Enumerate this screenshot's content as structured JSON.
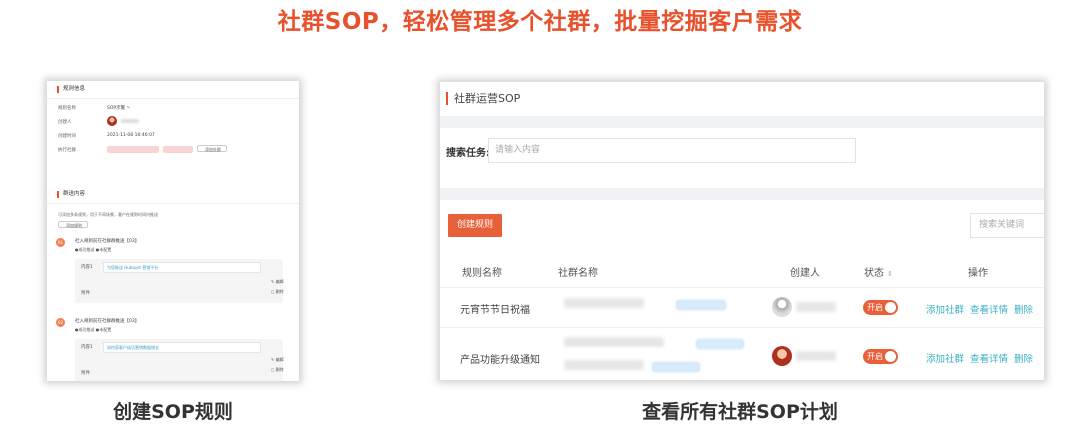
{
  "headline": "社群SOP，轻松管理多个社群，批量挖掘客户需求",
  "captions": {
    "left": "创建SOP规则",
    "right": "查看所有社群SOP计划"
  },
  "left_panel": {
    "section1": "规则信息",
    "fields": [
      {
        "label": "规则名称",
        "value": "SOP示警"
      },
      {
        "label": "创建人",
        "value": ""
      },
      {
        "label": "创建时间",
        "value": "2021-11-08 16:46:07"
      },
      {
        "label": "执行社群",
        "value": ""
      }
    ],
    "add_group_btn": "添加社群",
    "section2": "群送内容",
    "hint": "可添加多条规则，用于不同场景，客户在规则时间内推送",
    "add_rule_btn": "添加规则",
    "tasks": [
      {
        "badge": "01",
        "title": "社入规则前在社群群推送【03】",
        "sub": "●成功推送 ●未配置",
        "content_label": "内容1",
        "content": "为您推送 Hubspot 营销平台",
        "attach_label": "附件",
        "edit": "编辑",
        "delete": "删除"
      },
      {
        "badge": "02",
        "title": "社入规则前在社群群推送【03】",
        "sub": "●成功推送 ●未配置",
        "content_label": "内容1",
        "content": "如何获客户成功营销数据增长",
        "attach_label": "附件",
        "edit": "编辑",
        "delete": "删除"
      }
    ]
  },
  "right_panel": {
    "title": "社群运营SOP",
    "search_label": "搜索任务:",
    "search_placeholder": "请输入内容",
    "create_btn": "创建规则",
    "keyword_placeholder": "搜索关键词",
    "columns": [
      "规则名称",
      "社群名称",
      "创建人",
      "状态",
      "操作"
    ],
    "rows": [
      {
        "name": "元宵节节日祝福",
        "status": "开启",
        "actions": [
          "添加社群",
          "查看详情",
          "删除"
        ]
      },
      {
        "name": "产品功能升级通知",
        "status": "开启",
        "actions": [
          "添加社群",
          "查看详情",
          "删除"
        ]
      }
    ]
  },
  "colors": {
    "accent": "#e8512b",
    "link": "#3ab0c4"
  }
}
